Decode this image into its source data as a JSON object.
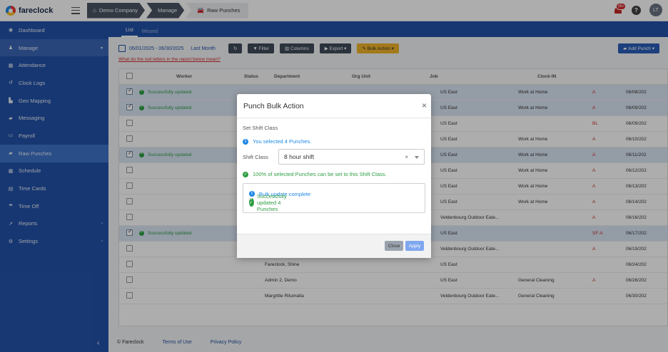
{
  "app": {
    "name": "fareclock"
  },
  "breadcrumb": [
    {
      "label": "Demo Company",
      "icon": "home-icon"
    },
    {
      "label": "Manage",
      "icon": ""
    },
    {
      "label": "Raw Punches",
      "icon": "car-icon"
    }
  ],
  "header": {
    "notifications_badge": "99+",
    "help_label": "?",
    "avatar_initials": "LT"
  },
  "sidebar": {
    "items": [
      {
        "label": "Dashboard",
        "icon": "dashboard-icon"
      },
      {
        "label": "Manage",
        "icon": "person-icon"
      },
      {
        "label": "Attendance",
        "icon": "attendance-icon"
      },
      {
        "label": "Clock Logs",
        "icon": "history-icon"
      },
      {
        "label": "Geo Mapping",
        "icon": "map-icon"
      },
      {
        "label": "Messaging",
        "icon": "chat-icon"
      },
      {
        "label": "Payroll",
        "icon": "payroll-icon"
      },
      {
        "label": "Raw Punches",
        "icon": "car-icon"
      },
      {
        "label": "Schedule",
        "icon": "calendar-icon"
      },
      {
        "label": "Time Cards",
        "icon": "card-icon"
      },
      {
        "label": "Time Off",
        "icon": "beach-icon"
      },
      {
        "label": "Reports",
        "icon": "chart-icon"
      },
      {
        "label": "Settings",
        "icon": "gear-icon"
      }
    ]
  },
  "tabs": [
    {
      "label": "List"
    },
    {
      "label": "Missed"
    }
  ],
  "toolbar": {
    "date_range": "06/01/2025 - 06/30/2025",
    "date_preset": "Last Month",
    "filter": "Filter",
    "columns": "Columns",
    "export": "Export",
    "bulk_action": "Bulk Action",
    "add_punch": "Add Punch"
  },
  "hint": "What do the red letters in the report below mean?",
  "table": {
    "columns": [
      "Status",
      "Worker",
      "Department",
      "Org Unit",
      "Job",
      "Clock-IN"
    ],
    "rows": [
      {
        "selected": true,
        "status": "Successfully updated",
        "worker": "",
        "dept": "",
        "org": "US East",
        "job": "Work at Home",
        "flag": "A",
        "clock": "06/08/202"
      },
      {
        "selected": true,
        "status": "Successfully updated",
        "worker": "",
        "dept": "",
        "org": "US East",
        "job": "Work at Home",
        "flag": "A",
        "clock": "06/09/202"
      },
      {
        "selected": false,
        "status": "",
        "worker": "",
        "dept": "",
        "org": "US East",
        "job": "",
        "flag": "BL",
        "clock": "06/09/202"
      },
      {
        "selected": false,
        "status": "",
        "worker": "",
        "dept": "",
        "org": "US East",
        "job": "Work at Home",
        "flag": "A",
        "clock": "06/10/202"
      },
      {
        "selected": true,
        "status": "Successfully updated",
        "worker": "",
        "dept": "",
        "org": "US East",
        "job": "Work at Home",
        "flag": "A",
        "clock": "06/11/202"
      },
      {
        "selected": false,
        "status": "",
        "worker": "",
        "dept": "",
        "org": "US East",
        "job": "Work at Home",
        "flag": "A",
        "clock": "06/12/202"
      },
      {
        "selected": false,
        "status": "",
        "worker": "",
        "dept": "",
        "org": "US East",
        "job": "Work at Home",
        "flag": "A",
        "clock": "06/13/202"
      },
      {
        "selected": false,
        "status": "",
        "worker": "",
        "dept": "",
        "org": "US East",
        "job": "Work at Home",
        "flag": "A",
        "clock": "06/14/202"
      },
      {
        "selected": false,
        "status": "",
        "worker": "",
        "dept": "",
        "org": "Veldenbourg Outdoor Eate...",
        "job": "",
        "flag": "A",
        "clock": "06/16/202"
      },
      {
        "selected": true,
        "status": "Successfully updated",
        "worker": "",
        "dept": "",
        "org": "US East",
        "job": "",
        "flag": "SF-A",
        "clock": "06/17/202"
      },
      {
        "selected": false,
        "status": "",
        "worker": "",
        "dept": "",
        "org": "Veldenbourg Outdoor Eate...",
        "job": "",
        "flag": "A",
        "clock": "06/19/202"
      },
      {
        "selected": false,
        "status": "",
        "worker": "Fareclock, Shine",
        "dept": "",
        "org": "US East",
        "job": "",
        "flag": "",
        "clock": "06/24/202"
      },
      {
        "selected": false,
        "status": "",
        "worker": "Admin 2, Demo",
        "dept": "",
        "org": "US East",
        "job": "General Cleaning",
        "flag": "A",
        "clock": "06/26/202"
      },
      {
        "selected": false,
        "status": "",
        "worker": "Margritte Ritumalta",
        "dept": "",
        "org": "Veldenbourg Outdoor Eate...",
        "job": "General Cleaning",
        "flag": "",
        "clock": "06/30/202"
      }
    ]
  },
  "footer": {
    "copyright": "© Fareclock",
    "terms": "Terms of Use",
    "privacy": "Privacy Policy"
  },
  "modal": {
    "title": "Punch Bulk Action",
    "close_glyph": "×",
    "section_label": "Set Shift Class",
    "selected_info": "You selected 4 Punches.",
    "shift_class_label": "Shift Class",
    "shift_class_value": "8 hour shift",
    "clear_glyph": "×",
    "eligibility": "100% of selected Punches can be set to this Shift Class.",
    "result_complete": "Bulk update complete",
    "result_updated": "Successfully updated 4 Punches",
    "close_button": "Close",
    "apply_button": "Apply"
  }
}
